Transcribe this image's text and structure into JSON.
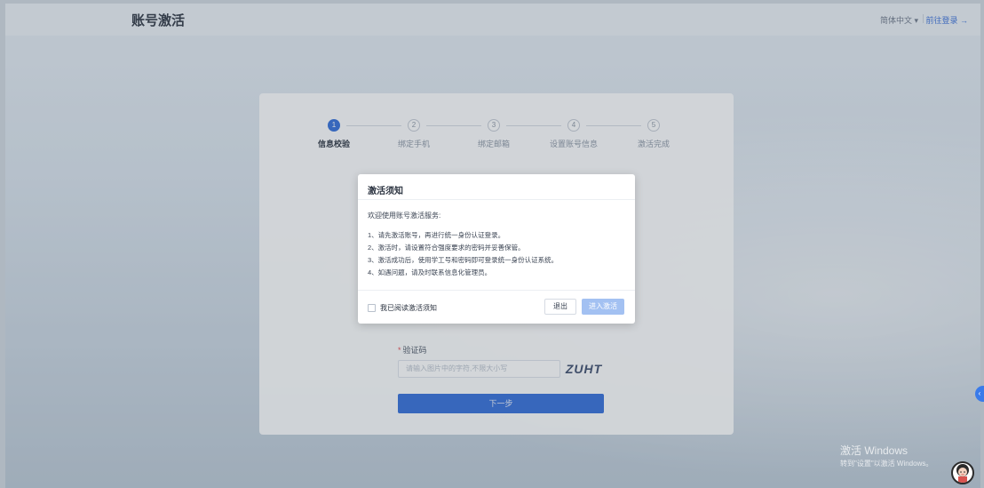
{
  "header": {
    "title": "账号激活",
    "language": "简体中文 ▾",
    "login_link": "前往登录 →"
  },
  "steps": [
    {
      "num": "1",
      "label": "信息校验",
      "active": true
    },
    {
      "num": "2",
      "label": "绑定手机",
      "active": false
    },
    {
      "num": "3",
      "label": "绑定邮箱",
      "active": false
    },
    {
      "num": "4",
      "label": "设置账号信息",
      "active": false
    },
    {
      "num": "5",
      "label": "激活完成",
      "active": false
    }
  ],
  "form": {
    "captcha_label": "验证码",
    "captcha_placeholder": "请输入图片中的字符,不限大小写",
    "captcha_text": "ZUHT",
    "next_button": "下一步"
  },
  "modal": {
    "title": "激活须知",
    "intro": "欢迎使用账号激活服务:",
    "items": [
      "1、请先激活账号，再进行统一身份认证登录。",
      "2、激活时，请设置符合强度要求的密码并妥善保管。",
      "3、激活成功后，使用学工号和密码即可登录统一身份认证系统。",
      "4、如遇问题，请及时联系信息化管理员。"
    ],
    "agree_label": "我已阅读激活须知",
    "exit_button": "退出",
    "enter_button": "进入激活"
  },
  "watermark": {
    "line1": "激活 Windows",
    "line2": "转到\"设置\"以激活 Windows。"
  }
}
